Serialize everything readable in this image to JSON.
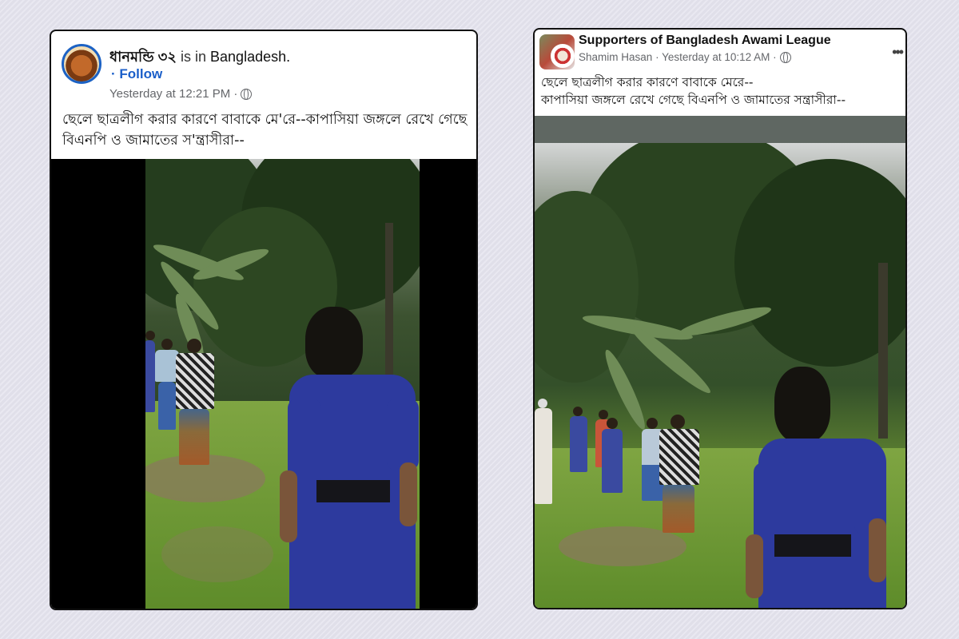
{
  "left_post": {
    "page_name": "ধানমন্ডি ৩২",
    "is_in": "is in",
    "location": "Bangladesh",
    "location_suffix": ".",
    "follow": "· Follow",
    "timestamp": "Yesterday at 12:21 PM ·",
    "caption": "ছেলে ছাত্রলীগ করার কারণে বাবাকে মে'রে--কাপাসিয়া জঙ্গলে রেখে গেছে বিএনপি ও জামাতের স'ন্ত্রাসীরা--"
  },
  "right_post": {
    "group_name": "Supporters of Bangladesh Awami League",
    "author": "Shamim Hasan",
    "timestamp": "· Yesterday at 10:12 AM ·",
    "caption_line1": "ছেলে ছাত্রলীগ করার কারণে বাবাকে মেরে--",
    "caption_line2": "কাপাসিয়া জঙ্গলে রেখে গেছে বিএনপি ও জামাতের সন্ত্রাসীরা--",
    "more_icon": "more-dots-icon"
  },
  "icons": {
    "privacy": "globe-icon"
  },
  "colors": {
    "link_blue": "#1b5fc9",
    "uniform_blue": "#2d3a9e",
    "background": "#e4e3ee"
  }
}
